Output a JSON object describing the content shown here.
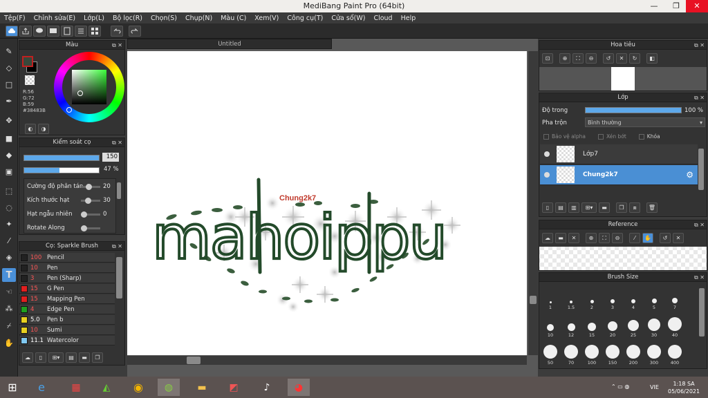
{
  "window": {
    "title": "MediBang Paint Pro (64bit)"
  },
  "menu": [
    "Tệp(F)",
    "Chỉnh sửa(E)",
    "Lớp(L)",
    "Bộ lọc(R)",
    "Chọn(S)",
    "Chụp(N)",
    "Màu (C)",
    "Xem(V)",
    "Công cụ(T)",
    "Cửa sổ(W)",
    "Cloud",
    "Help"
  ],
  "color_panel": {
    "title": "Màu",
    "r": "R:56",
    "g": "G:72",
    "b": "B:59",
    "hex": "#38483B",
    "fg": "#38483B",
    "bg": "#000000"
  },
  "control_panel": {
    "title": "Kiểm soát cọ",
    "size_value": "150",
    "size_fraction": 1.0,
    "opacity_value": "47 %",
    "opacity_fraction": 0.47,
    "params": [
      {
        "label": "Cường độ phân tán",
        "value": "20",
        "fraction": 0.3
      },
      {
        "label": "Kích thước hạt",
        "value": "30",
        "fraction": 0.25
      },
      {
        "label": "Hạt ngẫu nhiên",
        "value": "0",
        "fraction": 0.0
      },
      {
        "label": "Rotate Along",
        "value": "",
        "fraction": 0.0
      }
    ]
  },
  "brush_panel": {
    "title": "Cọ: Sparkle Brush",
    "items": [
      {
        "size": "100",
        "name": "Pencil",
        "color": "#222222",
        "size_color": "#ff5555"
      },
      {
        "size": "10",
        "name": "Pen",
        "color": "#222222",
        "size_color": "#ff5555"
      },
      {
        "size": "3",
        "name": "Pen (Sharp)",
        "color": "#222222",
        "size_color": "#ff5555"
      },
      {
        "size": "15",
        "name": "G Pen",
        "color": "#e02020",
        "size_color": "#ff5555"
      },
      {
        "size": "15",
        "name": "Mapping Pen",
        "color": "#e02020",
        "size_color": "#ff5555"
      },
      {
        "size": "4",
        "name": "Edge Pen",
        "color": "#20a020",
        "size_color": "#ff5555"
      },
      {
        "size": "5.0",
        "name": "Pen b",
        "color": "#e8d020",
        "size_color": "#ffffff"
      },
      {
        "size": "10",
        "name": "Sumi",
        "color": "#e8d020",
        "size_color": "#ff5555"
      },
      {
        "size": "11.1",
        "name": "Watercolor",
        "color": "#80c8f0",
        "size_color": "#ffffff"
      }
    ]
  },
  "document": {
    "tab": "Untitled",
    "small_text": "Chung2k7",
    "big_text": "mahoippu"
  },
  "navigator": {
    "title": "Hoa tiêu"
  },
  "layers": {
    "title": "Lớp",
    "opacity_label": "Độ trong",
    "opacity_value": "100 %",
    "opacity_fraction": 1.0,
    "blend_label": "Pha trộn",
    "blend_value": "Bình thường",
    "chk_alpha": "Bảo vệ alpha",
    "chk_clip": "Xén bớt",
    "chk_lock": "Khóa",
    "items": [
      {
        "name": "Lớp7",
        "selected": false
      },
      {
        "name": "Chung2k7",
        "selected": true
      }
    ]
  },
  "reference": {
    "title": "Reference"
  },
  "brush_size": {
    "title": "Brush Size",
    "sizes": [
      "1",
      "1.5",
      "2",
      "3",
      "4",
      "5",
      "7",
      "10",
      "12",
      "15",
      "20",
      "25",
      "30",
      "40",
      "50",
      "70",
      "100",
      "150",
      "200",
      "300",
      "400"
    ]
  },
  "taskbar": {
    "lang": "VIE",
    "time": "1:18 SA",
    "date": "05/06/2021"
  }
}
